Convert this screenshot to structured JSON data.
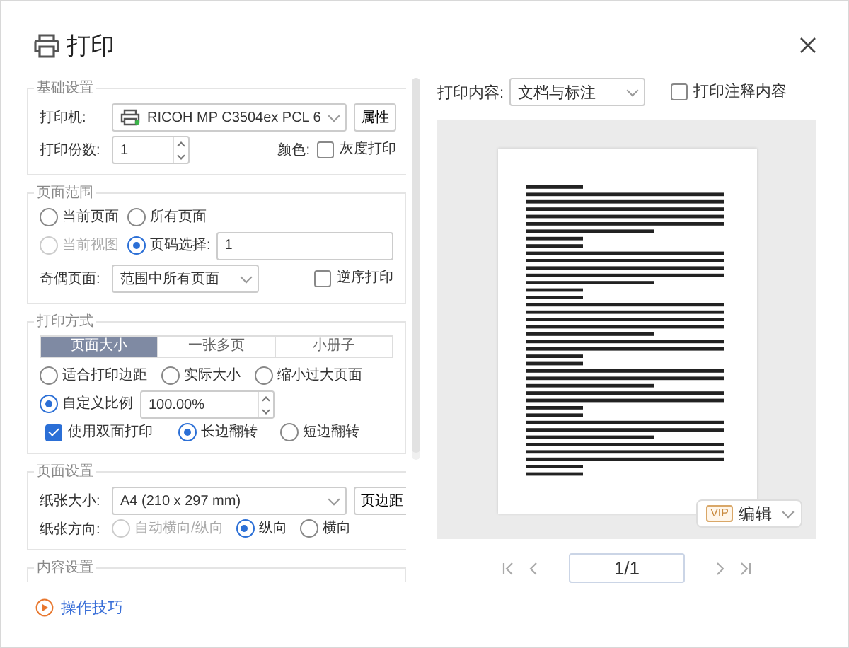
{
  "window": {
    "title": "打印"
  },
  "basic_settings": {
    "legend": "基础设置",
    "printer_label": "打印机:",
    "printer": "RICOH MP C3504ex PCL 6",
    "properties_button": "属性",
    "copies_label": "打印份数:",
    "copies": "1",
    "color_label": "颜色:",
    "grayscale": {
      "label": "灰度打印",
      "checked": false
    }
  },
  "page_range": {
    "legend": "页面范围",
    "options": [
      {
        "label": "当前页面",
        "selected": false,
        "disabled": false
      },
      {
        "label": "所有页面",
        "selected": false,
        "disabled": false
      },
      {
        "label": "当前视图",
        "selected": false,
        "disabled": true
      },
      {
        "label": "页码选择:",
        "selected": true,
        "disabled": false
      }
    ],
    "page_input": "1",
    "odd_even_label": "奇偶页面:",
    "odd_even": "范围中所有页面",
    "reverse": {
      "label": "逆序打印",
      "checked": false
    }
  },
  "print_mode": {
    "legend": "打印方式",
    "tabs": [
      {
        "label": "页面大小",
        "selected": true
      },
      {
        "label": "一张多页",
        "selected": false
      },
      {
        "label": "小册子",
        "selected": false
      }
    ],
    "scale_options": [
      {
        "label": "适合打印边距",
        "selected": false
      },
      {
        "label": "实际大小",
        "selected": false
      },
      {
        "label": "缩小过大页面",
        "selected": false
      },
      {
        "label": "自定义比例",
        "selected": true
      }
    ],
    "scale": "100.00%",
    "duplex": {
      "label": "使用双面打印",
      "checked": true
    },
    "flip_options": [
      {
        "label": "长边翻转",
        "selected": true
      },
      {
        "label": "短边翻转",
        "selected": false
      }
    ]
  },
  "page_setup": {
    "legend": "页面设置",
    "paper_size_label": "纸张大小:",
    "paper_size": "A4 (210 x 297 mm)",
    "margins_button": "页边距",
    "orientation_label": "纸张方向:",
    "orientations": [
      {
        "label": "自动横向/纵向",
        "selected": false,
        "disabled": true
      },
      {
        "label": "纵向",
        "selected": true,
        "disabled": false
      },
      {
        "label": "横向",
        "selected": false,
        "disabled": false
      }
    ]
  },
  "content_settings": {
    "legend": "内容设置"
  },
  "tips_link": "操作技巧",
  "preview": {
    "content_label": "打印内容:",
    "content": "文档与标注",
    "annotations": {
      "label": "打印注释内容",
      "checked": false
    },
    "vip_badge": "VIP",
    "edit_button": "编辑",
    "page_indicator": "1/1"
  }
}
